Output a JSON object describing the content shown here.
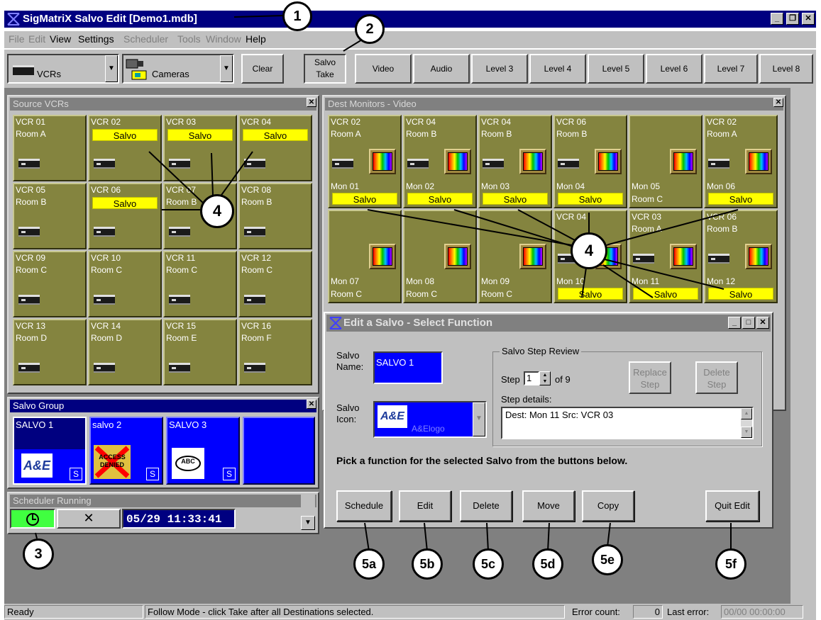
{
  "title_bar": {
    "title": "SigMatriX  Salvo Edit  [Demo1.mdb]"
  },
  "menu": [
    "File",
    "Edit",
    "View",
    "Settings",
    "Scheduler",
    "Tools",
    "Window",
    "Help"
  ],
  "toolbar": {
    "source_combo": "VCRs",
    "dest_combo": "Cameras",
    "clear": "Clear",
    "salvo_take_line1": "Salvo",
    "salvo_take_line2": "Take",
    "levels": [
      "Video",
      "Audio",
      "Level 3",
      "Level 4",
      "Level 5",
      "Level 6",
      "Level 7",
      "Level 8"
    ]
  },
  "source_window": {
    "title": "Source VCRs",
    "salvo_label": "Salvo",
    "tiles": [
      {
        "name": "VCR 01",
        "room": "Room A",
        "salvo": false
      },
      {
        "name": "VCR 02",
        "room": "",
        "salvo": true
      },
      {
        "name": "VCR 03",
        "room": "",
        "salvo": true
      },
      {
        "name": "VCR 04",
        "room": "",
        "salvo": true
      },
      {
        "name": "VCR 05",
        "room": "Room B",
        "salvo": false
      },
      {
        "name": "VCR 06",
        "room": "",
        "salvo": true
      },
      {
        "name": "VCR 07",
        "room": "Room B",
        "salvo": false
      },
      {
        "name": "VCR 08",
        "room": "Room B",
        "salvo": false
      },
      {
        "name": "VCR 09",
        "room": "Room C",
        "salvo": false
      },
      {
        "name": "VCR 10",
        "room": "Room C",
        "salvo": false
      },
      {
        "name": "VCR 11",
        "room": "Room C",
        "salvo": false
      },
      {
        "name": "VCR 12",
        "room": "Room C",
        "salvo": false
      },
      {
        "name": "VCR 13",
        "room": "Room D",
        "salvo": false
      },
      {
        "name": "VCR 14",
        "room": "Room D",
        "salvo": false
      },
      {
        "name": "VCR 15",
        "room": "Room E",
        "salvo": false
      },
      {
        "name": "VCR 16",
        "room": "Room F",
        "salvo": false
      }
    ]
  },
  "dest_window": {
    "title": "Dest Monitors - Video",
    "row1": [
      {
        "src": "VCR 02",
        "room": "Room A",
        "mon": "Mon 01",
        "sub": "Salvo",
        "vcr": true
      },
      {
        "src": "VCR 04",
        "room": "Room B",
        "mon": "Mon 02",
        "sub": "Salvo",
        "vcr": true
      },
      {
        "src": "VCR 04",
        "room": "Room B",
        "mon": "Mon 03",
        "sub": "Salvo",
        "vcr": true
      },
      {
        "src": "VCR 06",
        "room": "Room B",
        "mon": "Mon 04",
        "sub": "Salvo",
        "vcr": true
      },
      {
        "src": "",
        "room": "",
        "mon": "Mon 05",
        "sub": "Room C",
        "vcr": false
      },
      {
        "src": "VCR 02",
        "room": "Room A",
        "mon": "Mon 06",
        "sub": "Salvo",
        "vcr": true
      }
    ],
    "row2": [
      {
        "src": "",
        "room": "",
        "mon": "Mon 07",
        "sub": "Room C",
        "vcr": false
      },
      {
        "src": "",
        "room": "",
        "mon": "Mon 08",
        "sub": "Room C",
        "vcr": false
      },
      {
        "src": "",
        "room": "",
        "mon": "Mon 09",
        "sub": "Room C",
        "vcr": false
      },
      {
        "src": "VCR 04",
        "room": "",
        "mon": "Mon 10",
        "sub": "Salvo",
        "vcr": true
      },
      {
        "src": "VCR 03",
        "room": "Room A",
        "mon": "Mon 11",
        "sub": "Salvo",
        "vcr": true
      },
      {
        "src": "VCR 06",
        "room": "Room B",
        "mon": "Mon 12",
        "sub": "Salvo",
        "vcr": true
      }
    ]
  },
  "salvo_group": {
    "title": "Salvo Group",
    "tiles": [
      {
        "name": "SALVO 1",
        "badge": "S",
        "icon": "ae-logo-icon"
      },
      {
        "name": "salvo 2",
        "badge": "S",
        "icon": "access-denied-icon"
      },
      {
        "name": "SALVO 3",
        "badge": "S",
        "icon": "abc-logo-icon"
      },
      {
        "name": "",
        "badge": "",
        "icon": ""
      }
    ],
    "ae_text": "A&E",
    "access_text": "ACCESS DENIED",
    "abc_text": "ABC"
  },
  "scheduler": {
    "title": "Scheduler Running",
    "clock": "05/29  11:33:41",
    "cancel_glyph": "✕"
  },
  "dialog": {
    "title": "Edit a Salvo - Select Function",
    "name_label_1": "Salvo",
    "name_label_2": "Name:",
    "name_value": "SALVO 1",
    "icon_label_1": "Salvo",
    "icon_label_2": "Icon:",
    "icon_value": "A&Elogo",
    "icon_glyph": "A&E",
    "step_group_title": "Salvo Step Review",
    "step_label": "Step",
    "step_value": "1",
    "step_of": "of 9",
    "replace_1": "Replace",
    "replace_2": "Step",
    "delete_1": "Delete",
    "delete_2": "Step",
    "details_label": "Step details:",
    "details_value": "Dest: Mon 11  Src: VCR 03",
    "instruction": "Pick a function for the selected Salvo from the buttons below.",
    "buttons": [
      "Schedule",
      "Edit",
      "Delete",
      "Move",
      "Copy",
      "Quit Edit"
    ]
  },
  "status_bar": {
    "ready": "Ready",
    "message": "Follow Mode - click Take after all Destinations selected.",
    "error_count_label": "Error count:",
    "error_count": "0",
    "last_error_label": "Last error:",
    "last_error": "00/00  00:00:00"
  },
  "callouts": [
    "1",
    "2",
    "3",
    "4",
    "4",
    "4",
    "5a",
    "5b",
    "5c",
    "5d",
    "5e",
    "5f"
  ],
  "colors": {
    "tile_olive": "#84843f",
    "salvo_yellow": "#ffff00",
    "salvo_blue": "#0000ff",
    "title_navy": "#000080"
  }
}
